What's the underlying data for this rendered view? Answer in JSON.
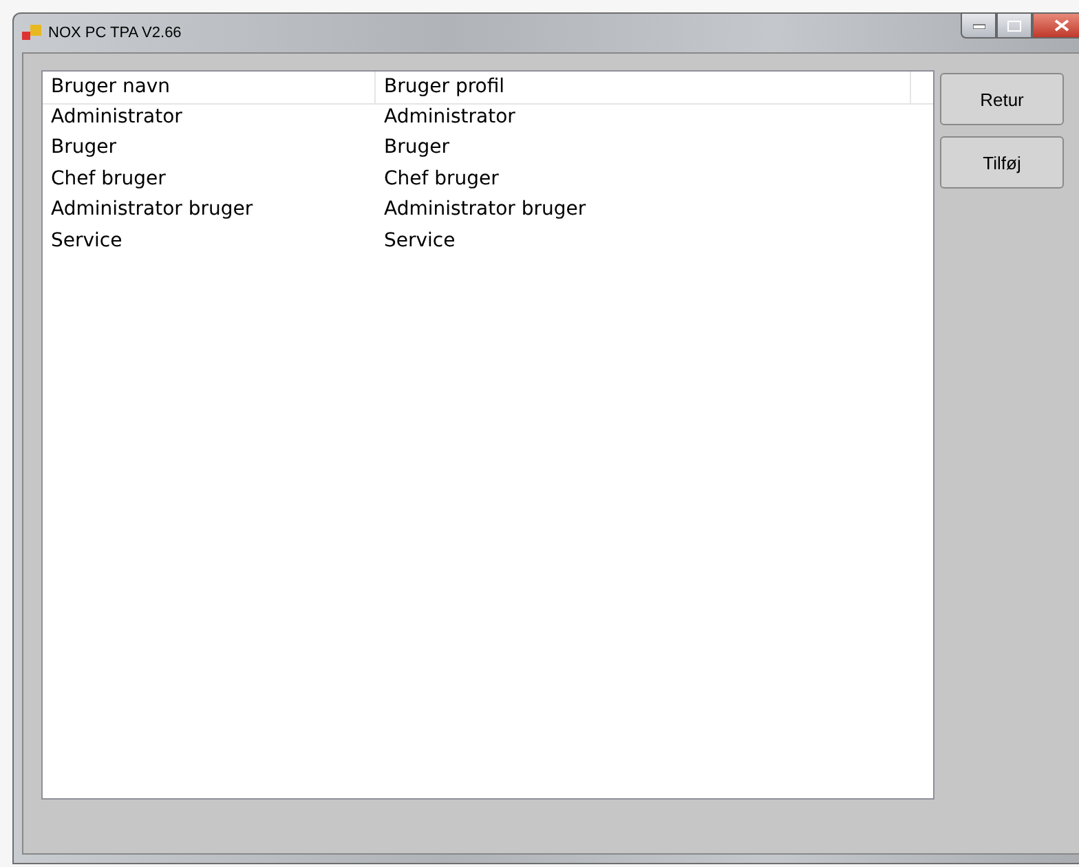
{
  "window": {
    "title": "NOX PC TPA V2.66"
  },
  "table": {
    "columns": [
      "Bruger navn",
      "Bruger profil"
    ],
    "rows": [
      [
        "Administrator",
        "Administrator"
      ],
      [
        "Bruger",
        "Bruger"
      ],
      [
        "Chef bruger",
        "Chef bruger"
      ],
      [
        "Administrator bruger",
        "Administrator bruger"
      ],
      [
        "Service",
        "Service"
      ]
    ]
  },
  "buttons": [
    "Retur",
    "Tilføj"
  ]
}
